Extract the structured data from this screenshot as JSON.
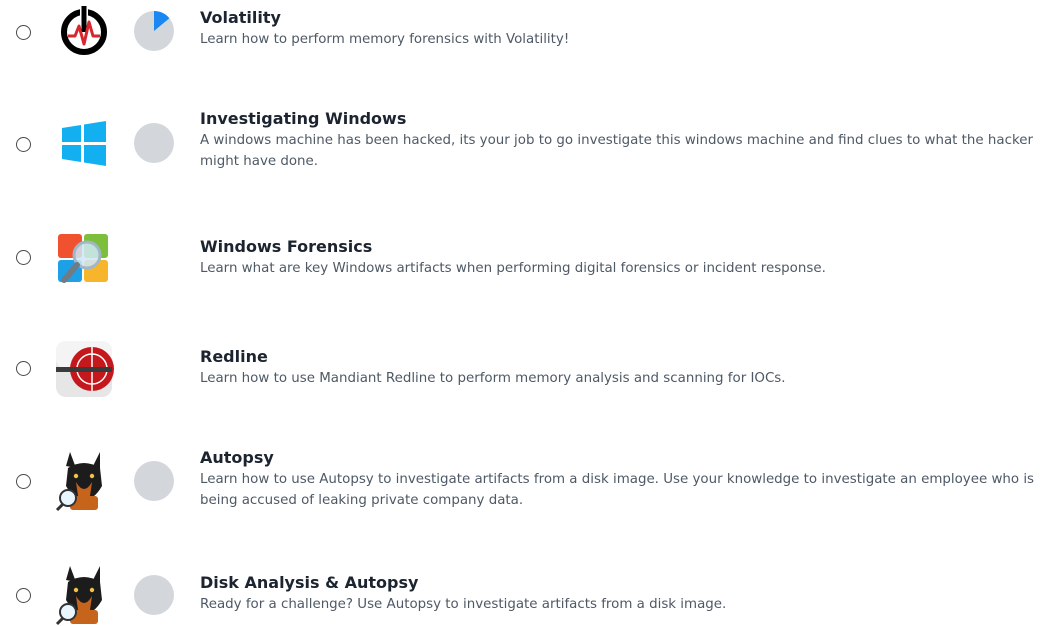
{
  "rooms": [
    {
      "title": "Volatility",
      "description": "Learn how to perform memory forensics with Volatility!",
      "logo_icon": "volatility-power-icon",
      "progress": 0.14
    },
    {
      "title": "Investigating Windows",
      "description": "A windows machine has been hacked, its your job to go investigate this windows machine and find clues to what the hacker might have done.",
      "logo_icon": "windows-logo-icon",
      "progress": 0
    },
    {
      "title": "Windows Forensics",
      "description": "Learn what are key Windows artifacts when performing digital forensics or incident response.",
      "logo_icon": "windows-forensics-magnifier-icon",
      "progress": null
    },
    {
      "title": "Redline",
      "description": "Learn how to use Mandiant Redline to perform memory analysis and scanning for IOCs.",
      "logo_icon": "redline-logo-icon",
      "progress": null
    },
    {
      "title": "Autopsy",
      "description": "Learn how to use Autopsy to investigate artifacts from a disk image. Use your knowledge to investigate an employee who is being accused of leaking private company data.",
      "logo_icon": "autopsy-dog-icon",
      "progress": 0
    },
    {
      "title": "Disk Analysis & Autopsy",
      "description": "Ready for a challenge? Use Autopsy to investigate artifacts from a disk image.",
      "logo_icon": "autopsy-dog-icon",
      "progress": 0
    }
  ],
  "colors": {
    "progress_track": "#d3d6db",
    "progress_fill": "#1a88f0",
    "title": "#1c2430",
    "description": "#4e5965"
  }
}
